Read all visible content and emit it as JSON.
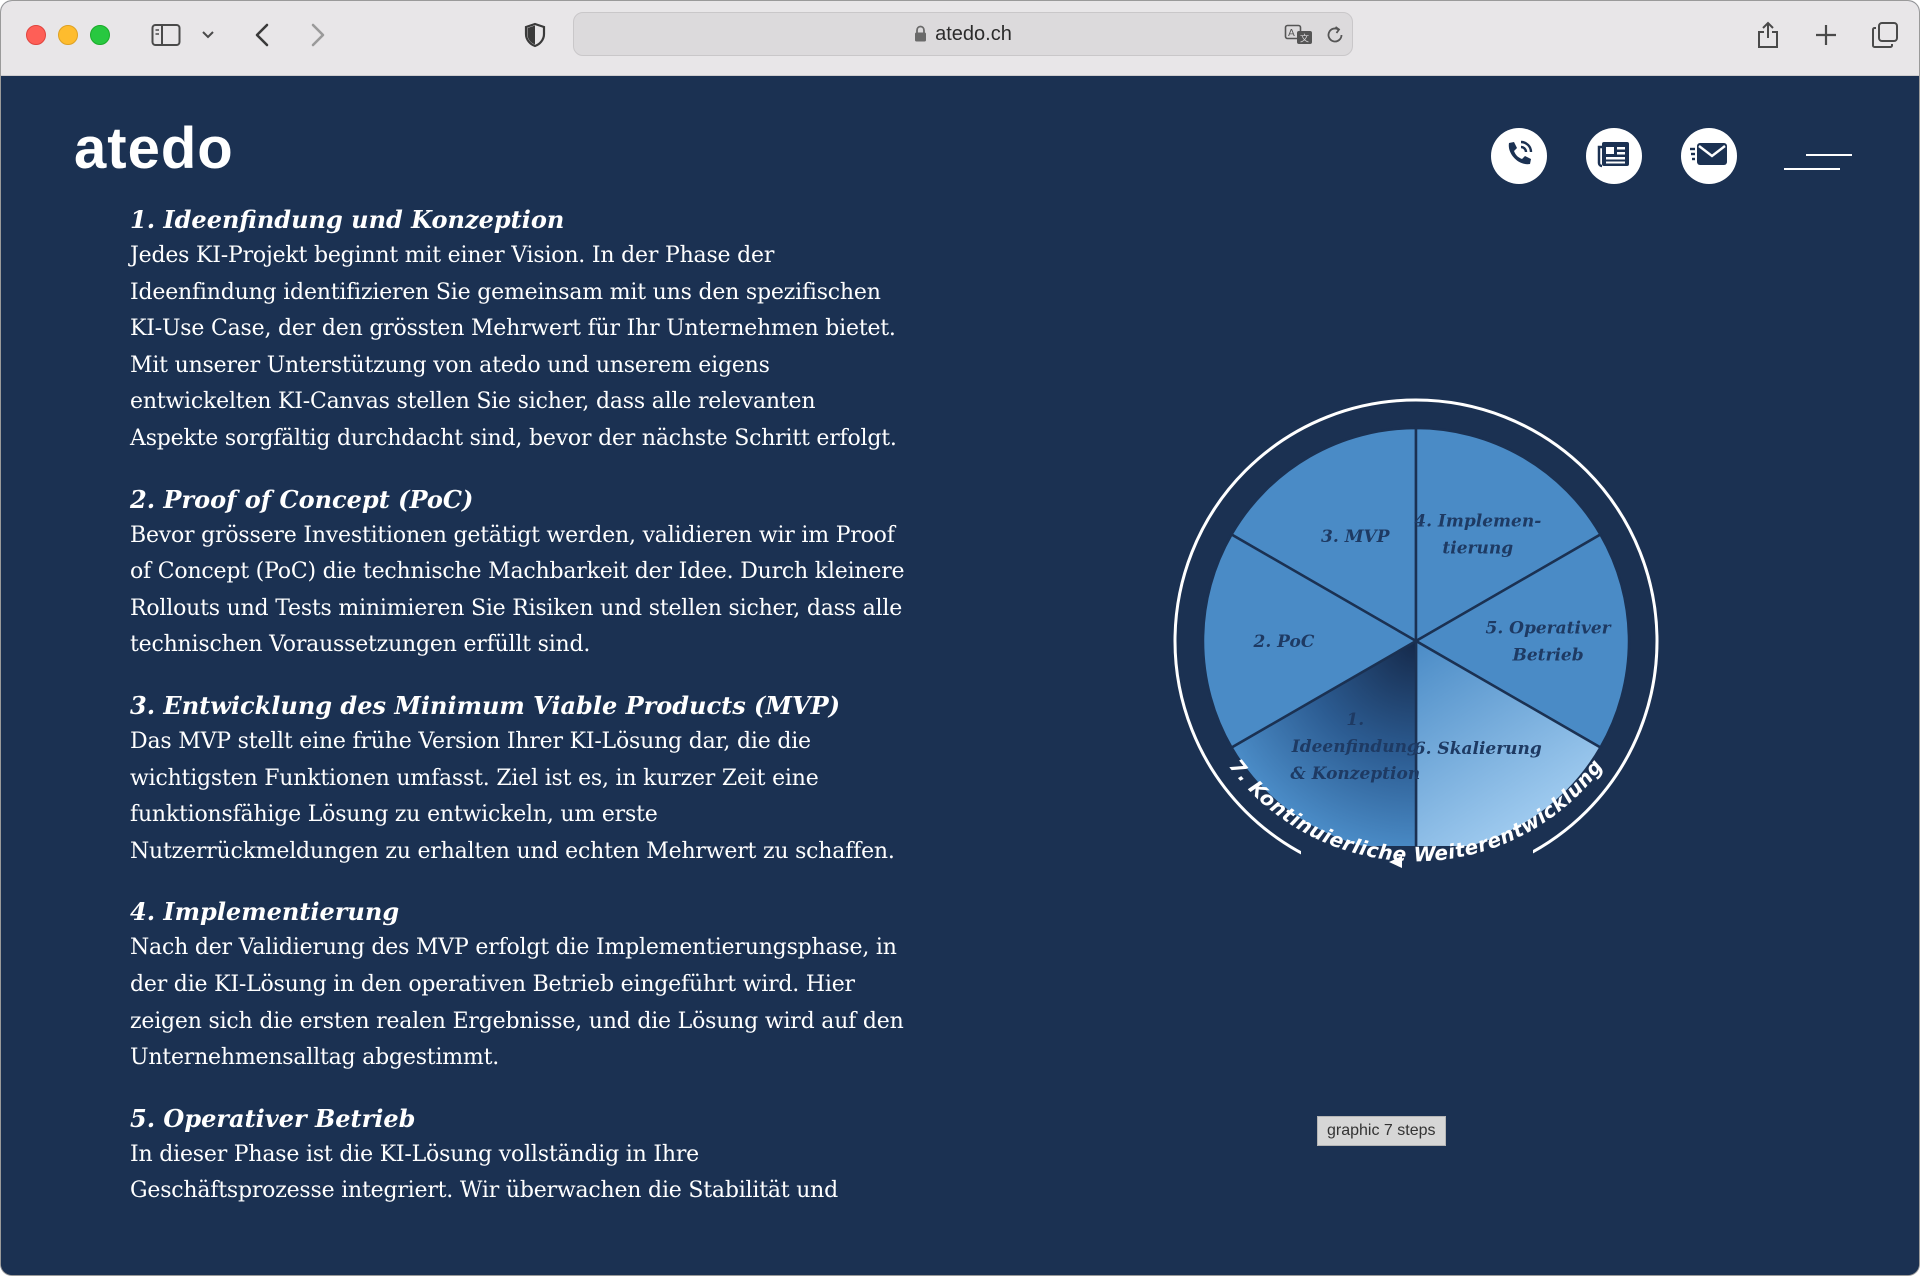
{
  "browser": {
    "url": "atedo.ch",
    "icons": [
      "sidebar-toggle-icon",
      "chevron-down-icon",
      "back-icon",
      "forward-icon",
      "shield-icon",
      "lock-icon",
      "translate-icon",
      "reload-icon",
      "share-icon",
      "new-tab-icon",
      "tabs-overview-icon"
    ]
  },
  "header": {
    "logo": "atedo",
    "buttons": [
      "phone-icon",
      "news-icon",
      "mail-icon",
      "menu-icon"
    ]
  },
  "sections": [
    {
      "title": "1. Ideenfindung und Konzeption",
      "body": "Jedes KI-Projekt beginnt mit einer Vision. In der Phase der Ideenfindung identifizieren Sie gemeinsam mit uns den spezifischen KI-Use Case, der den grössten Mehrwert für Ihr Unternehmen bietet. Mit unserer Unterstützung von atedo und unserem eigens entwickelten KI-Canvas stellen Sie sicher, dass alle relevanten Aspekte sorgfältig durchdacht sind, bevor der nächste Schritt erfolgt."
    },
    {
      "title": "2. Proof of Concept (PoC)",
      "body": "Bevor grössere Investitionen getätigt werden, validieren wir im Proof of Concept (PoC) die technische Machbarkeit der Idee. Durch kleinere Rollouts und Tests minimieren Sie Risiken und stellen sicher, dass alle technischen Voraussetzungen erfüllt sind."
    },
    {
      "title": "3. Entwicklung des Minimum Viable Products (MVP)",
      "body": "Das MVP stellt eine frühe Version Ihrer KI-Lösung dar, die die wichtigsten Funktionen umfasst. Ziel ist es, in kurzer Zeit eine funktionsfähige Lösung zu entwickeln, um erste Nutzerrückmeldungen zu erhalten und echten Mehrwert zu schaffen."
    },
    {
      "title": "4. Implementierung",
      "body": "Nach der Validierung des MVP erfolgt die Implementierungsphase, in der die KI-Lösung in den operativen Betrieb eingeführt wird. Hier zeigen sich die ersten realen Ergebnisse, und die Lösung wird auf den Unternehmensalltag abgestimmt."
    },
    {
      "title": "5. Operativer Betrieb",
      "body": "In dieser Phase ist die KI-Lösung vollständig in Ihre Geschäftsprozesse integriert. Wir überwachen die Stabilität und"
    }
  ],
  "diagram": {
    "segments": [
      {
        "lines": [
          "3. MVP"
        ]
      },
      {
        "lines": [
          "4. Implemen-",
          "tierung"
        ]
      },
      {
        "lines": [
          "5. Operativer",
          "Betrieb"
        ]
      },
      {
        "lines": [
          "6. Skalierung"
        ]
      },
      {
        "lines": [
          "1.",
          "Ideenfindung",
          "& Konzeption"
        ]
      },
      {
        "lines": [
          "2. PoC"
        ]
      }
    ],
    "cycle_label": "7. Kontinuierliche Weiterentwicklung",
    "colors": {
      "segment": "#4a8bc6",
      "highlight": "#9cc7ec",
      "dark": "#1e3a63",
      "divider": "#1b3152"
    }
  },
  "caption": "graphic 7 steps"
}
